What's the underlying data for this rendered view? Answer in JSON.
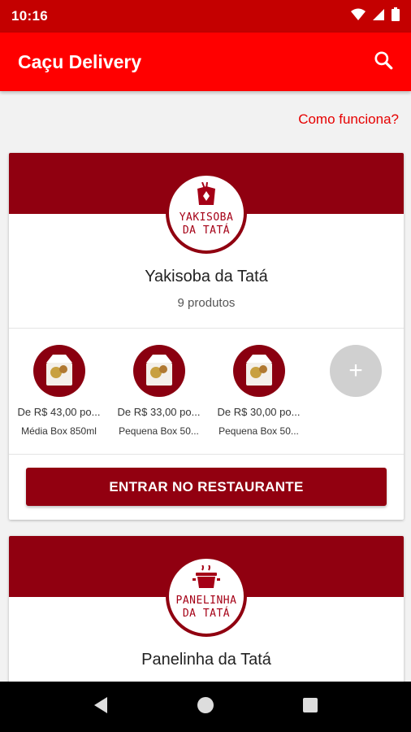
{
  "status": {
    "time": "10:16"
  },
  "app": {
    "title": "Caçu Delivery"
  },
  "links": {
    "how_it_works": "Como funciona?"
  },
  "restaurants": [
    {
      "logo_text_line1": "YAKISOBA",
      "logo_text_line2": "DA TATÁ",
      "name": "Yakisoba da Tatá",
      "count": "9 produtos",
      "products": [
        {
          "price": "De R$ 43,00 po...",
          "name": "Média Box 850ml"
        },
        {
          "price": "De R$ 33,00 po...",
          "name": "Pequena Box 50..."
        },
        {
          "price": "De R$ 30,00 po...",
          "name": "Pequena Box 50..."
        }
      ],
      "more_label": "+",
      "enter_label": "ENTRAR NO RESTAURANTE"
    },
    {
      "logo_text_line1": "PANELINHA",
      "logo_text_line2": "DA TATÁ",
      "name": "Panelinha da Tatá"
    }
  ],
  "colors": {
    "status_bar": "#c40000",
    "app_bar": "#ff0000",
    "brand_dark": "#900010",
    "link": "#e60000"
  }
}
